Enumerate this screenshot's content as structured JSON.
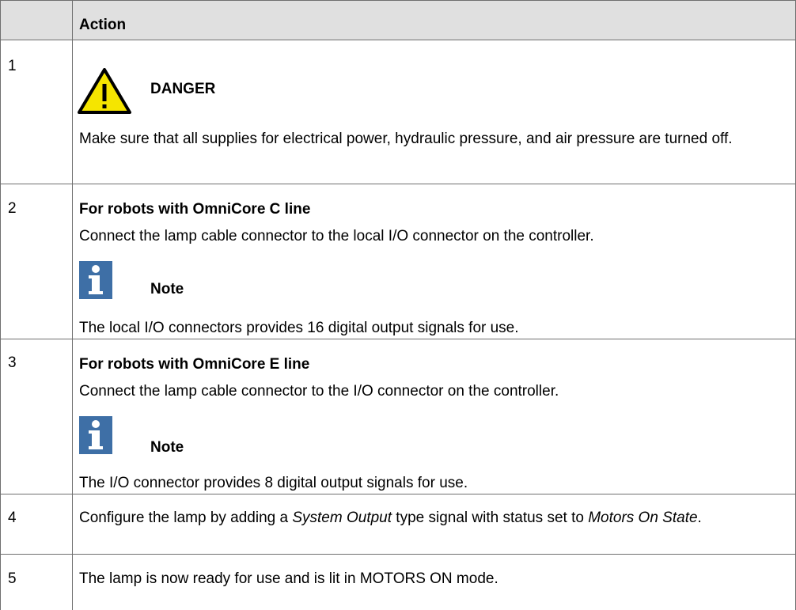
{
  "table": {
    "header": {
      "number_col": "",
      "action_col": "Action"
    },
    "rows": [
      {
        "step": "1",
        "danger_title": "DANGER",
        "danger_text": "Make sure that all supplies for electrical power, hydraulic pressure, and air pressure are turned off."
      },
      {
        "step": "2",
        "heading": "For robots with OmniCore C line",
        "text": "Connect the lamp cable connector to the local I/O connector on the controller.",
        "note_title": "Note",
        "note_text": "The local I/O connectors provides 16 digital output signals for use."
      },
      {
        "step": "3",
        "heading": "For robots with OmniCore E line",
        "text": "Connect the lamp cable connector to the I/O connector on the controller.",
        "note_title": "Note",
        "note_text": "The I/O connector provides 8 digital output signals for use."
      },
      {
        "step": "4",
        "text_a": "Configure the lamp by adding a ",
        "text_b": "System Output",
        "text_c": " type signal with status set to ",
        "text_d": "Motors On State",
        "text_e": "."
      },
      {
        "step": "5",
        "text": "The lamp is now ready for use and is lit in MOTORS ON mode."
      }
    ]
  },
  "colors": {
    "header_bg": "#e0e0e0",
    "grid": "#6f6f6f",
    "warning_yellow": "#f5e500",
    "note_blue": "#3e6fa6"
  },
  "icons": {
    "danger": "warning-triangle-icon",
    "note": "info-icon"
  }
}
